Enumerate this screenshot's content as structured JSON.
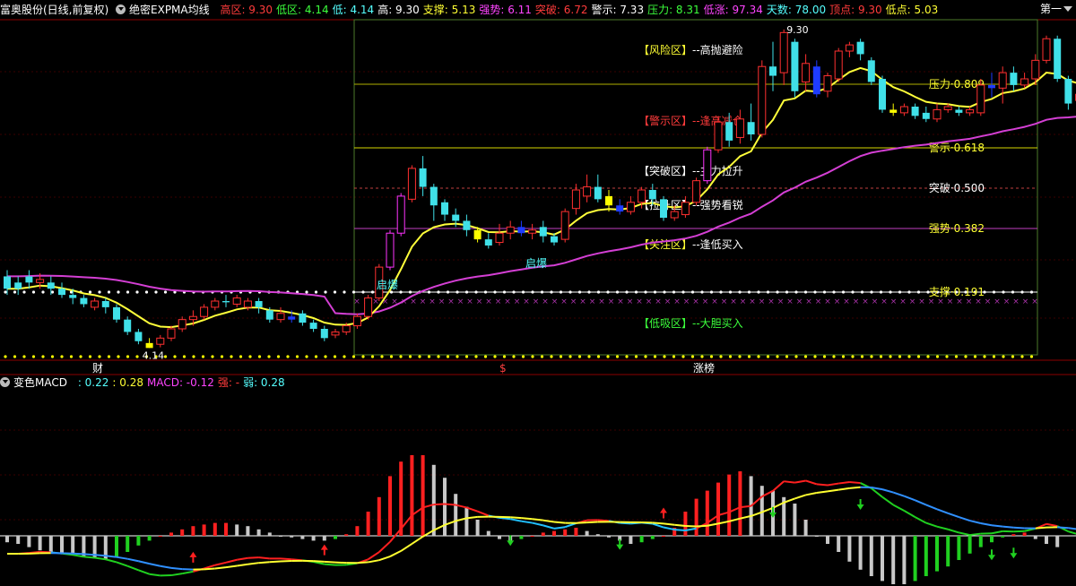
{
  "header": {
    "stock_name": "富奥股份(日线,前复权)",
    "indicator_name": "绝密EXPMA均线",
    "next_label": "第一",
    "stats": [
      {
        "label": "高区:",
        "value": "9.30",
        "color": "#ff3b3b"
      },
      {
        "label": "低区:",
        "value": "4.14",
        "color": "#3cff3c"
      },
      {
        "label": "低:",
        "value": "4.14",
        "color": "#55ffff"
      },
      {
        "label": "高:",
        "value": "9.30",
        "color": "#ffffff"
      },
      {
        "label": "支撑:",
        "value": "5.13",
        "color": "#ffff33"
      },
      {
        "label": "强势:",
        "value": "6.11",
        "color": "#ff44ff"
      },
      {
        "label": "突破:",
        "value": "6.72",
        "color": "#ff3b3b"
      },
      {
        "label": "警示:",
        "value": "7.33",
        "color": "#ffffff"
      },
      {
        "label": "压力:",
        "value": "8.31",
        "color": "#3cff3c"
      },
      {
        "label": "低涨:",
        "value": "97.34",
        "color": "#ff44ff"
      },
      {
        "label": "天数:",
        "value": "78.00",
        "color": "#55ffff"
      },
      {
        "label": "顶点:",
        "value": "9.30",
        "color": "#ff3b3b"
      },
      {
        "label": "低点:",
        "value": "5.03",
        "color": "#ffff33"
      }
    ]
  },
  "macd_header": {
    "name": "变色MACD",
    "items": [
      {
        "label": ":",
        "value": "0.22",
        "color": "#55ffff"
      },
      {
        "label": ":",
        "value": "0.28",
        "color": "#ffff33"
      },
      {
        "label": "MACD:",
        "value": "-0.12",
        "color": "#ff44ff"
      },
      {
        "label": "强:",
        "value": "-",
        "color": "#ff3b3b"
      },
      {
        "label": "弱:",
        "value": "0.28",
        "color": "#55ffff"
      }
    ]
  },
  "zones": [
    {
      "bracket": "【风险区】",
      "desc": "--高抛避险",
      "bracket_color": "#ffff33",
      "desc_color": "#ffffff"
    },
    {
      "bracket": "【警示区】",
      "desc": "--逢高减仓",
      "bracket_color": "#ff3b3b",
      "desc_color": "#ff3b3b"
    },
    {
      "bracket": "【突破区】",
      "desc": "--主力拉升",
      "bracket_color": "#ffffff",
      "desc_color": "#ffffff"
    },
    {
      "bracket": "【拉升区】",
      "desc": "--强势看锐",
      "bracket_color": "#ffffff",
      "desc_color": "#ffffff"
    },
    {
      "bracket": "【关注区】",
      "desc": "--逢低买入",
      "bracket_color": "#ffff33",
      "desc_color": "#ffffff"
    },
    {
      "bracket": "【低吸区】",
      "desc": "--大胆买入",
      "bracket_color": "#3cff3c",
      "desc_color": "#3cff3c"
    }
  ],
  "fib_levels": [
    {
      "label": "压力",
      "value": "0.809",
      "color": "#ffff33"
    },
    {
      "label": "警示",
      "value": "0.618",
      "color": "#ffff33"
    },
    {
      "label": "突破",
      "value": "0.500",
      "color": "#ffffff"
    },
    {
      "label": "强势",
      "value": "0.382",
      "color": "#ffff33"
    },
    {
      "label": "支撑",
      "value": "0.191",
      "color": "#ffff33"
    }
  ],
  "annotations": {
    "high_price": "9.30",
    "low_price": "4.14",
    "signal_1": "启爆",
    "signal_2": "启爆",
    "xaxis_1": "财",
    "xaxis_2": "$",
    "xaxis_3": "涨榜"
  },
  "chart_data": [
    {
      "type": "candlestick",
      "ylim": [
        4.0,
        9.4
      ],
      "candles": [
        {
          "o": 5.3,
          "c": 5.1,
          "h": 5.4,
          "l": 5.0
        },
        {
          "o": 5.2,
          "c": 5.1,
          "h": 5.3,
          "l": 5.0
        },
        {
          "o": 5.3,
          "c": 5.2,
          "h": 5.4,
          "l": 5.1
        },
        {
          "o": 5.2,
          "c": 5.25,
          "h": 5.35,
          "l": 5.1
        },
        {
          "o": 5.2,
          "c": 5.1,
          "h": 5.3,
          "l": 5.0
        },
        {
          "o": 5.1,
          "c": 5.0,
          "h": 5.2,
          "l": 4.95
        },
        {
          "o": 5.0,
          "c": 4.95,
          "h": 5.1,
          "l": 4.85
        },
        {
          "o": 4.95,
          "c": 4.85,
          "h": 5.0,
          "l": 4.8
        },
        {
          "o": 4.8,
          "c": 4.9,
          "h": 4.95,
          "l": 4.75
        },
        {
          "o": 4.9,
          "c": 4.8,
          "h": 4.95,
          "l": 4.7
        },
        {
          "o": 4.8,
          "c": 4.6,
          "h": 4.85,
          "l": 4.55
        },
        {
          "o": 4.6,
          "c": 4.4,
          "h": 4.65,
          "l": 4.35
        },
        {
          "o": 4.4,
          "c": 4.25,
          "h": 4.45,
          "l": 4.2
        },
        {
          "o": 4.22,
          "c": 4.14,
          "h": 4.3,
          "l": 4.14
        },
        {
          "o": 4.2,
          "c": 4.3,
          "h": 4.35,
          "l": 4.15
        },
        {
          "o": 4.3,
          "c": 4.45,
          "h": 4.5,
          "l": 4.25
        },
        {
          "o": 4.45,
          "c": 4.6,
          "h": 4.65,
          "l": 4.4
        },
        {
          "o": 4.6,
          "c": 4.65,
          "h": 4.75,
          "l": 4.5
        },
        {
          "o": 4.65,
          "c": 4.8,
          "h": 4.85,
          "l": 4.6
        },
        {
          "o": 4.8,
          "c": 4.9,
          "h": 4.95,
          "l": 4.75
        },
        {
          "o": 4.9,
          "c": 4.88,
          "h": 5.0,
          "l": 4.8
        },
        {
          "o": 4.85,
          "c": 4.95,
          "h": 5.0,
          "l": 4.8
        },
        {
          "o": 4.8,
          "c": 4.9,
          "h": 4.95,
          "l": 4.75
        },
        {
          "o": 4.9,
          "c": 4.8,
          "h": 4.95,
          "l": 4.7
        },
        {
          "o": 4.75,
          "c": 4.6,
          "h": 4.8,
          "l": 4.55
        },
        {
          "o": 4.6,
          "c": 4.7,
          "h": 4.8,
          "l": 4.55
        },
        {
          "o": 4.65,
          "c": 4.6,
          "h": 4.75,
          "l": 4.55
        },
        {
          "o": 4.7,
          "c": 4.55,
          "h": 4.75,
          "l": 4.5
        },
        {
          "o": 4.55,
          "c": 4.45,
          "h": 4.6,
          "l": 4.4
        },
        {
          "o": 4.45,
          "c": 4.3,
          "h": 4.5,
          "l": 4.25
        },
        {
          "o": 4.35,
          "c": 4.4,
          "h": 4.45,
          "l": 4.3
        },
        {
          "o": 4.4,
          "c": 4.5,
          "h": 4.55,
          "l": 4.35
        },
        {
          "o": 4.5,
          "c": 4.65,
          "h": 4.7,
          "l": 4.45
        },
        {
          "o": 4.65,
          "c": 4.95,
          "h": 5.0,
          "l": 4.6
        },
        {
          "o": 4.95,
          "c": 5.45,
          "h": 5.5,
          "l": 4.9
        },
        {
          "o": 5.45,
          "c": 6.0,
          "h": 6.05,
          "l": 5.4
        },
        {
          "o": 6.0,
          "c": 6.6,
          "h": 6.65,
          "l": 5.95
        },
        {
          "o": 6.55,
          "c": 7.05,
          "h": 7.1,
          "l": 6.5
        },
        {
          "o": 7.05,
          "c": 6.75,
          "h": 7.25,
          "l": 6.6
        },
        {
          "o": 6.75,
          "c": 6.45,
          "h": 6.8,
          "l": 6.2
        },
        {
          "o": 6.5,
          "c": 6.3,
          "h": 6.55,
          "l": 6.2
        },
        {
          "o": 6.3,
          "c": 6.2,
          "h": 6.4,
          "l": 6.1
        },
        {
          "o": 6.2,
          "c": 6.05,
          "h": 6.3,
          "l": 5.95
        },
        {
          "o": 6.05,
          "c": 5.9,
          "h": 6.1,
          "l": 5.85
        },
        {
          "o": 5.9,
          "c": 5.8,
          "h": 6.0,
          "l": 5.75
        },
        {
          "o": 5.85,
          "c": 6.0,
          "h": 6.15,
          "l": 5.8
        },
        {
          "o": 6.0,
          "c": 6.1,
          "h": 6.2,
          "l": 5.9
        },
        {
          "o": 6.1,
          "c": 6.0,
          "h": 6.2,
          "l": 5.95
        },
        {
          "o": 6.0,
          "c": 6.05,
          "h": 6.15,
          "l": 5.9
        },
        {
          "o": 6.1,
          "c": 5.95,
          "h": 6.2,
          "l": 5.85
        },
        {
          "o": 5.95,
          "c": 5.85,
          "h": 6.0,
          "l": 5.8
        },
        {
          "o": 5.9,
          "c": 6.35,
          "h": 6.4,
          "l": 5.85
        },
        {
          "o": 6.4,
          "c": 6.7,
          "h": 6.8,
          "l": 6.3
        },
        {
          "o": 6.6,
          "c": 6.75,
          "h": 6.95,
          "l": 6.5
        },
        {
          "o": 6.75,
          "c": 6.55,
          "h": 6.95,
          "l": 6.5
        },
        {
          "o": 6.6,
          "c": 6.45,
          "h": 6.7,
          "l": 6.35
        },
        {
          "o": 6.45,
          "c": 6.35,
          "h": 6.55,
          "l": 6.3
        },
        {
          "o": 6.35,
          "c": 6.5,
          "h": 6.6,
          "l": 6.3
        },
        {
          "o": 6.5,
          "c": 6.7,
          "h": 6.75,
          "l": 6.4
        },
        {
          "o": 6.7,
          "c": 6.55,
          "h": 6.8,
          "l": 6.45
        },
        {
          "o": 6.55,
          "c": 6.25,
          "h": 6.6,
          "l": 6.2
        },
        {
          "o": 6.25,
          "c": 6.35,
          "h": 6.45,
          "l": 6.2
        },
        {
          "o": 6.3,
          "c": 6.5,
          "h": 6.6,
          "l": 6.25
        },
        {
          "o": 6.5,
          "c": 6.85,
          "h": 6.9,
          "l": 6.45
        },
        {
          "o": 6.85,
          "c": 7.35,
          "h": 7.4,
          "l": 6.8
        },
        {
          "o": 7.35,
          "c": 7.8,
          "h": 7.9,
          "l": 7.3
        },
        {
          "o": 7.8,
          "c": 7.5,
          "h": 7.95,
          "l": 7.4
        },
        {
          "o": 7.55,
          "c": 7.85,
          "h": 8.0,
          "l": 7.45
        },
        {
          "o": 7.8,
          "c": 7.6,
          "h": 8.1,
          "l": 7.5
        },
        {
          "o": 7.6,
          "c": 8.7,
          "h": 8.8,
          "l": 7.55
        },
        {
          "o": 8.7,
          "c": 8.55,
          "h": 9.1,
          "l": 8.3
        },
        {
          "o": 8.6,
          "c": 9.25,
          "h": 9.3,
          "l": 8.4
        },
        {
          "o": 9.1,
          "c": 8.3,
          "h": 9.15,
          "l": 8.2
        },
        {
          "o": 8.45,
          "c": 8.75,
          "h": 8.9,
          "l": 8.3
        },
        {
          "o": 8.7,
          "c": 8.25,
          "h": 8.8,
          "l": 8.2
        },
        {
          "o": 8.3,
          "c": 8.55,
          "h": 8.6,
          "l": 8.2
        },
        {
          "o": 8.5,
          "c": 8.95,
          "h": 9.0,
          "l": 8.45
        },
        {
          "o": 8.95,
          "c": 9.05,
          "h": 9.1,
          "l": 8.85
        },
        {
          "o": 9.1,
          "c": 8.9,
          "h": 9.15,
          "l": 8.8
        },
        {
          "o": 8.8,
          "c": 8.45,
          "h": 8.85,
          "l": 8.4
        },
        {
          "o": 8.5,
          "c": 8.0,
          "h": 8.55,
          "l": 7.95
        },
        {
          "o": 8.0,
          "c": 7.95,
          "h": 8.1,
          "l": 7.9
        },
        {
          "o": 7.95,
          "c": 8.05,
          "h": 8.1,
          "l": 7.9
        },
        {
          "o": 8.05,
          "c": 7.9,
          "h": 8.1,
          "l": 7.85
        },
        {
          "o": 7.95,
          "c": 7.85,
          "h": 8.05,
          "l": 7.8
        },
        {
          "o": 7.85,
          "c": 8.0,
          "h": 8.1,
          "l": 7.8
        },
        {
          "o": 8.0,
          "c": 8.05,
          "h": 8.1,
          "l": 7.95
        },
        {
          "o": 8.0,
          "c": 7.95,
          "h": 8.05,
          "l": 7.9
        },
        {
          "o": 7.95,
          "c": 8.0,
          "h": 8.05,
          "l": 7.9
        },
        {
          "o": 7.95,
          "c": 8.4,
          "h": 8.5,
          "l": 7.9
        },
        {
          "o": 8.4,
          "c": 8.35,
          "h": 8.6,
          "l": 8.2
        },
        {
          "o": 8.35,
          "c": 8.6,
          "h": 8.7,
          "l": 8.1
        },
        {
          "o": 8.6,
          "c": 8.4,
          "h": 8.7,
          "l": 8.3
        },
        {
          "o": 8.4,
          "c": 8.5,
          "h": 8.6,
          "l": 8.35
        },
        {
          "o": 8.5,
          "c": 8.8,
          "h": 8.9,
          "l": 8.4
        },
        {
          "o": 8.8,
          "c": 9.15,
          "h": 9.2,
          "l": 8.75
        },
        {
          "o": 9.15,
          "c": 8.5,
          "h": 9.2,
          "l": 8.45
        },
        {
          "o": 8.5,
          "c": 8.1,
          "h": 8.55,
          "l": 8.0
        },
        {
          "o": 8.15,
          "c": 8.25,
          "h": 8.35,
          "l": 8.05
        }
      ]
    },
    {
      "type": "bar",
      "series_name": "MACD",
      "ylim": [
        -0.9,
        1.1
      ],
      "values": [
        -0.08,
        -0.1,
        -0.14,
        -0.18,
        -0.2,
        -0.22,
        -0.24,
        -0.26,
        -0.28,
        -0.3,
        -0.26,
        -0.2,
        -0.12,
        -0.06,
        0.0,
        0.04,
        0.08,
        0.12,
        0.14,
        0.16,
        0.16,
        0.14,
        0.12,
        0.08,
        0.04,
        0.0,
        -0.02,
        -0.04,
        -0.06,
        -0.06,
        -0.04,
        0.02,
        0.12,
        0.3,
        0.48,
        0.74,
        0.92,
        1.0,
        1.0,
        0.88,
        0.72,
        0.52,
        0.36,
        0.2,
        0.06,
        -0.04,
        -0.06,
        -0.04,
        0.0,
        0.04,
        0.06,
        0.08,
        0.1,
        0.06,
        0.02,
        -0.02,
        -0.06,
        -0.1,
        -0.08,
        -0.04,
        0.0,
        0.1,
        0.3,
        0.46,
        0.56,
        0.66,
        0.76,
        0.8,
        0.74,
        0.62,
        0.56,
        0.48,
        0.4,
        0.2,
        0.0,
        -0.1,
        -0.2,
        -0.32,
        -0.42,
        -0.5,
        -0.56,
        -0.6,
        -0.6,
        -0.56,
        -0.5,
        -0.44,
        -0.38,
        -0.3,
        -0.22,
        -0.14,
        -0.08,
        -0.02,
        0.02,
        0.04,
        -0.04,
        -0.1,
        -0.14
      ]
    }
  ]
}
